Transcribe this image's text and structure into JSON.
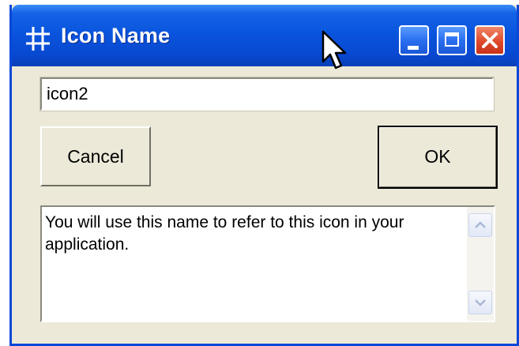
{
  "window": {
    "title": "Icon Name",
    "controls": {
      "minimize": "minimize",
      "maximize": "maximize",
      "close": "close"
    }
  },
  "name_field": {
    "value": "icon2"
  },
  "buttons": {
    "cancel_label": "Cancel",
    "ok_label": "OK"
  },
  "info": {
    "text": "You will use this name to refer to this icon in your application."
  },
  "colors": {
    "titlebar": "#0a55de",
    "dialog_face": "#ece9d8",
    "close_button": "#de4a2a"
  },
  "icons": [
    "grid-icon",
    "minimize-icon",
    "maximize-icon",
    "close-icon",
    "scroll-up-icon",
    "scroll-down-icon",
    "mouse-cursor-icon"
  ]
}
